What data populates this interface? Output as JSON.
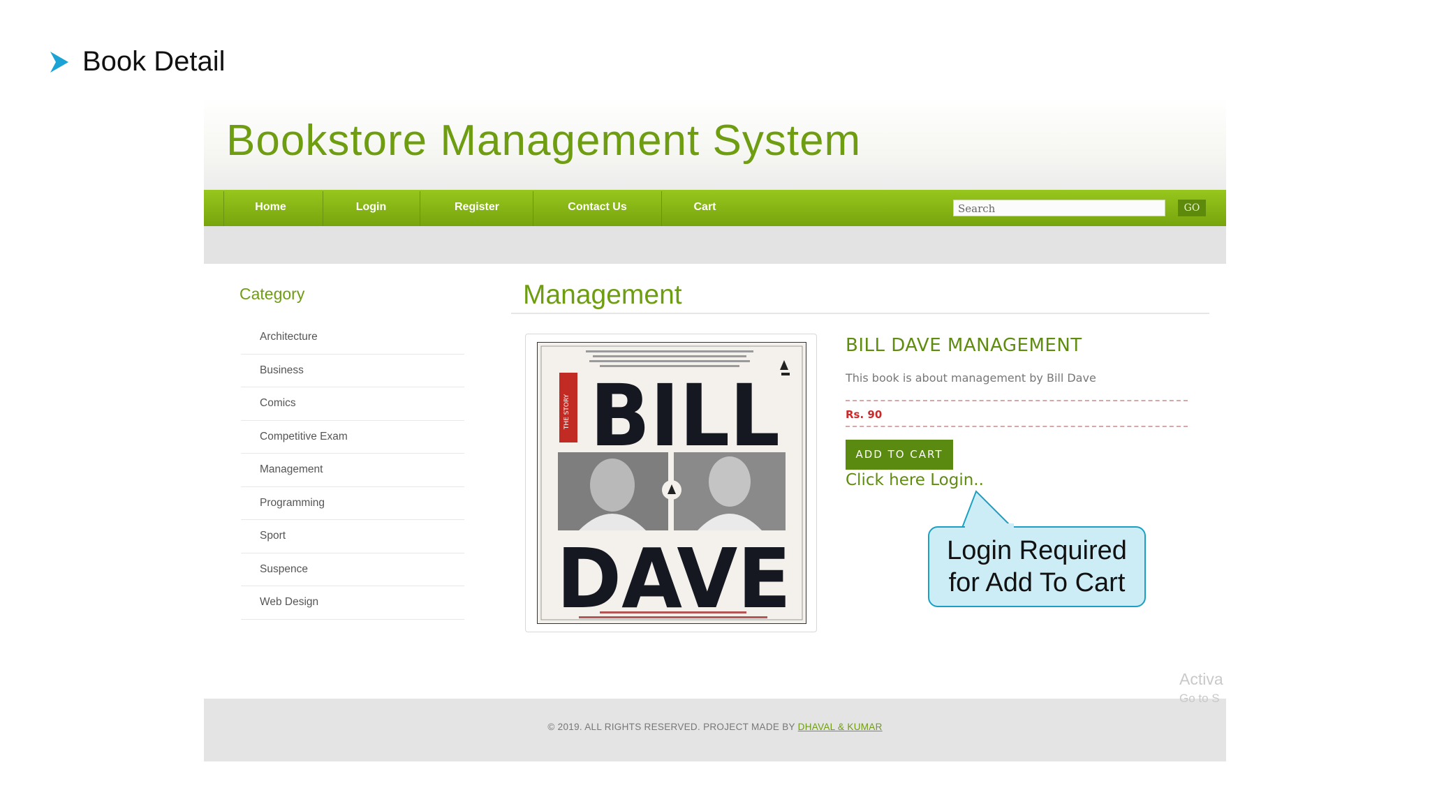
{
  "slide": {
    "heading": "Book Detail"
  },
  "site": {
    "title": "Bookstore Management System",
    "nav": [
      "Home",
      "Login",
      "Register",
      "Contact Us",
      "Cart"
    ],
    "search": {
      "placeholder": "Search",
      "button": "GO"
    },
    "sidebar": {
      "title": "Category",
      "items": [
        "Architecture",
        "Business",
        "Comics",
        "Competitive Exam",
        "Management",
        "Programming",
        "Sport",
        "Suspence",
        "Web Design"
      ]
    },
    "main": {
      "title": "Management",
      "book": {
        "name": "BILL DAVE MANAGEMENT",
        "description": "This book is about management by Bill Dave",
        "price": "Rs. 90",
        "add_to_cart": "ADD TO CART",
        "login_link": "Click here Login..",
        "cover": {
          "line1": "BILL",
          "line2": "DAVE"
        }
      }
    },
    "footer": {
      "text": "© 2019. ALL RIGHTS RESERVED. PROJECT MADE BY",
      "link": "DHAVAL & KUMAR"
    },
    "watermark": {
      "line1": "Activa",
      "line2": "Go to S"
    }
  },
  "callout": {
    "line1": "Login Required",
    "line2": "for Add To Cart"
  },
  "colors": {
    "brand_green": "#6f9d12",
    "nav_green": "#88b716",
    "price_red": "#cc2a2a",
    "callout_fill": "#ccecf6",
    "callout_border": "#19a0c3"
  }
}
